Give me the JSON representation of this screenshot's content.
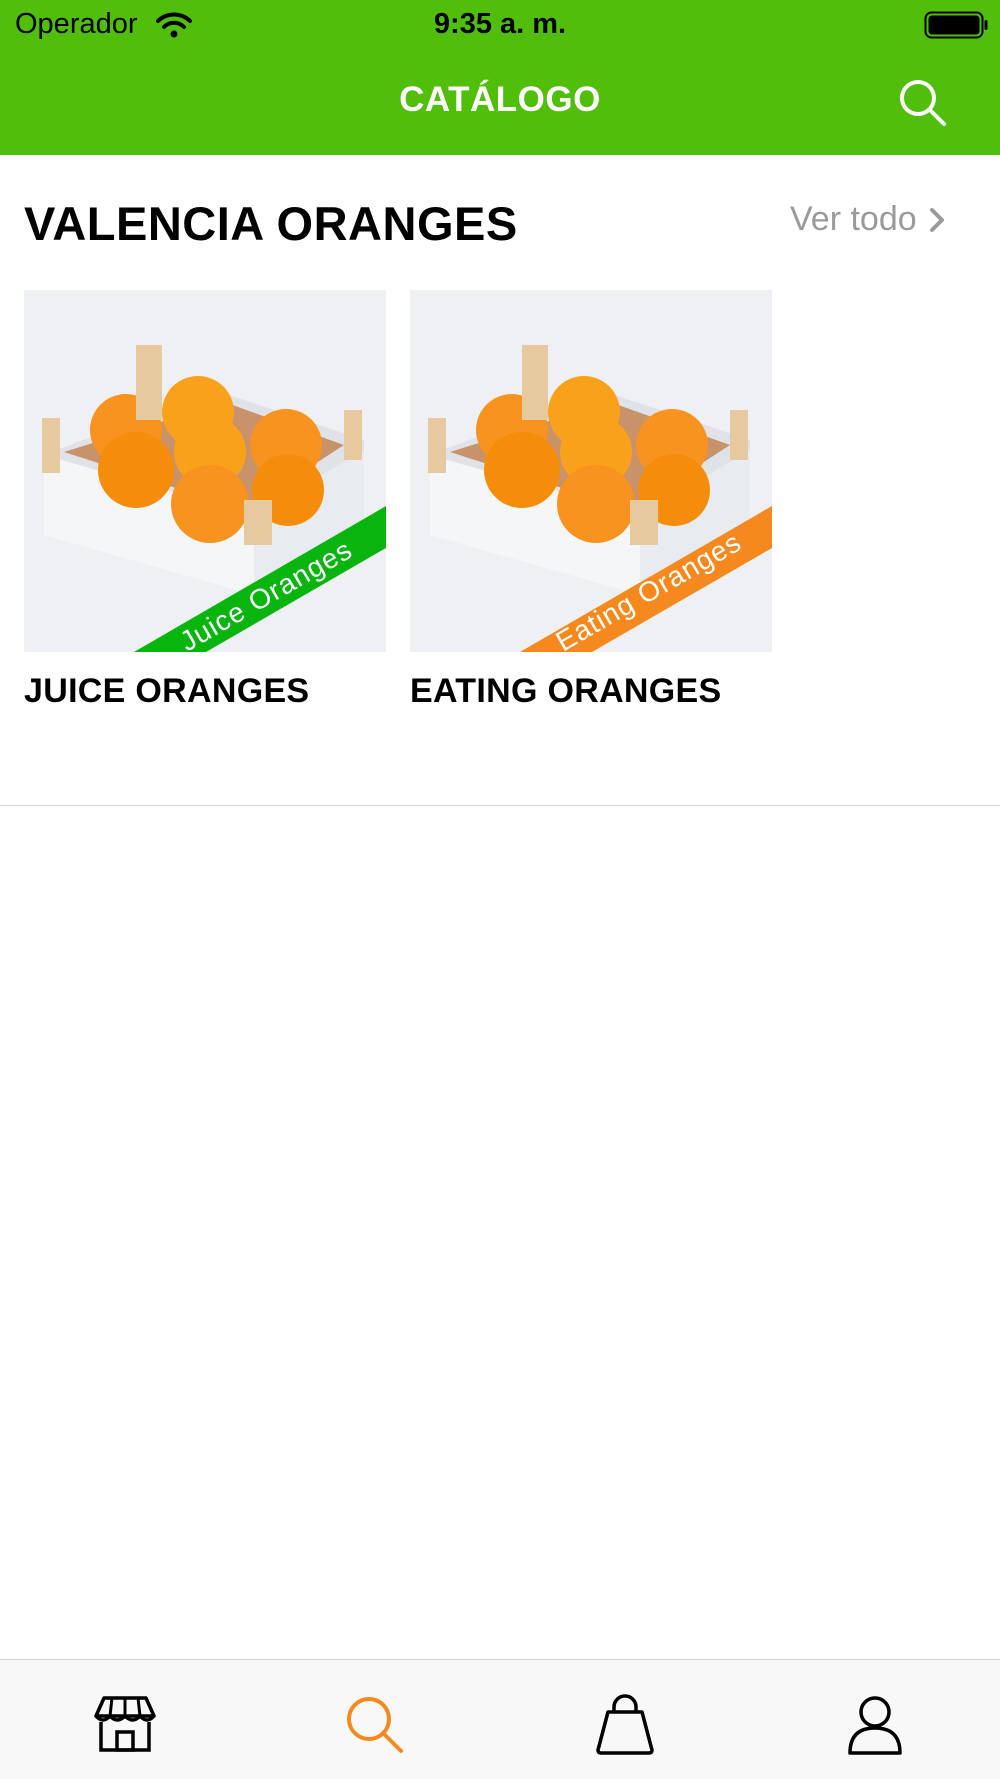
{
  "status_bar": {
    "carrier": "Operador",
    "time": "9:35 a. m."
  },
  "nav": {
    "title": "CATÁLOGO",
    "search_icon": "search-icon"
  },
  "section": {
    "title": "VALENCIA ORANGES",
    "see_all": "Ver todo",
    "products": [
      {
        "name": "JUICE ORANGES",
        "ribbon": "Juice Oranges",
        "ribbon_color": "#08b50f"
      },
      {
        "name": "EATING ORANGES",
        "ribbon": "Eating Oranges",
        "ribbon_color": "#f5891e"
      }
    ]
  },
  "tabbar": {
    "items": [
      {
        "icon": "store-icon"
      },
      {
        "icon": "search-icon",
        "active": true
      },
      {
        "icon": "shopping-bag-icon"
      },
      {
        "icon": "profile-icon"
      }
    ],
    "active_color": "#f5891e"
  },
  "colors": {
    "header": "#50be0a",
    "see_all": "#9a9a9a"
  }
}
